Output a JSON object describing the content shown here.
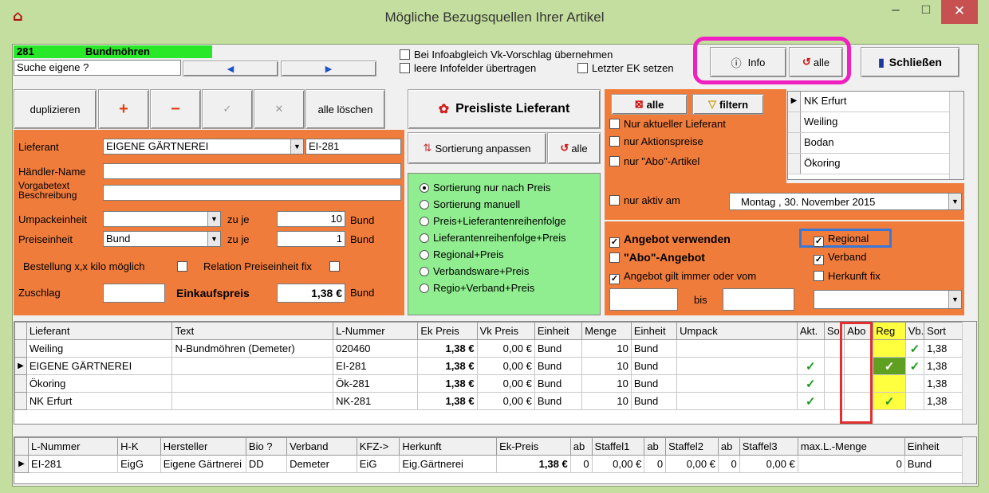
{
  "window": {
    "title": "Mögliche Bezugsquellen Ihrer Artikel",
    "minimize": "–",
    "maximize": "□",
    "close": "✕"
  },
  "article": {
    "number": "281",
    "name": "Bundmöhren",
    "search_placeholder": "Suche eigene ?"
  },
  "options": {
    "vk_vorschlag": "Bei Infoabgleich  Vk-Vorschlag übernehmen",
    "leere_felder": "leere Infofelder übertragen",
    "letzter_ek": "Letzter EK setzen"
  },
  "toolbar": {
    "info": "Info",
    "alle": "alle",
    "schliessen": "Schließen",
    "duplizieren": "duplizieren",
    "alle_loeschen": "alle löschen",
    "preisliste": "Preisliste Lieferant",
    "sortierung_anpassen": "Sortierung anpassen",
    "alle2": "alle"
  },
  "form": {
    "lieferant_label": "Lieferant",
    "lieferant_value": "EIGENE GÄRTNEREI",
    "lieferant_code": "EI-281",
    "haendler_label": "Händler-Name",
    "vorgabe_label1": "Vorgabetext",
    "vorgabe_label2": "Beschreibung",
    "umpack_label": "Umpackeinheit",
    "zuje1": "zu je",
    "umpack_qty": "10",
    "umpack_unit": "Bund",
    "preiseinheit_label": "Preiseinheit",
    "preiseinheit_value": "Bund",
    "zuje2": "zu je",
    "preis_qty": "1",
    "preis_unit": "Bund",
    "bestellung": "Bestellung x,x kilo möglich",
    "relation": "Relation Preiseinheit fix",
    "zuschlag_label": "Zuschlag",
    "einkaufspreis_label": "Einkaufspreis",
    "einkaufspreis_value": "1,38 €",
    "einkaufspreis_unit": "Bund"
  },
  "sort_options": [
    {
      "label": "Sortierung nur nach Preis",
      "selected": true
    },
    {
      "label": "Sortierung manuell",
      "selected": false
    },
    {
      "label": "Preis+Lieferantenreihenfolge",
      "selected": false
    },
    {
      "label": "Lieferantenreihenfolge+Preis",
      "selected": false
    },
    {
      "label": "Regional+Preis",
      "selected": false
    },
    {
      "label": "Verbandsware+Preis",
      "selected": false
    },
    {
      "label": "Regio+Verband+Preis",
      "selected": false
    }
  ],
  "filter": {
    "alle": "alle",
    "filtern": "filtern",
    "aktueller": "Nur aktueller Lieferant",
    "aktion": "nur Aktionspreise",
    "abo": "nur \"Abo\"-Artikel",
    "aktiv_am": "nur aktiv am",
    "date_day": "Montag",
    "date_rest": ", 30. November 2015",
    "lieferanten": [
      "NK Erfurt",
      "Weiling",
      "Bodan",
      "Ökoring"
    ]
  },
  "angebot": {
    "verwenden": "Angebot verwenden",
    "abo": "\"Abo\"-Angebot",
    "immer": "Angebot gilt immer  oder vom",
    "bis": "bis",
    "regional": "Regional",
    "verband": "Verband",
    "herkunft": "Herkunft fix"
  },
  "main_table": {
    "headers": [
      "Lieferant",
      "Text",
      "L-Nummer",
      "Ek Preis",
      "Vk Preis",
      "Einheit",
      "Menge",
      "Einheit",
      "Umpack",
      "Akt.",
      "So",
      "Abo",
      "Reg",
      "Vb.",
      "Sort"
    ],
    "rows": [
      [
        "Weiling",
        "N-Bundmöhren (Demeter)",
        "020460",
        "1,38 €",
        "0,00 €",
        "Bund",
        "10",
        "Bund",
        "",
        "",
        "",
        "",
        "",
        "✓",
        "1,38"
      ],
      [
        "EIGENE GÄRTNEREI",
        "",
        "EI-281",
        "1,38 €",
        "0,00 €",
        "Bund",
        "10",
        "Bund",
        "",
        "✓",
        "",
        "",
        "✓",
        "✓",
        "1,38"
      ],
      [
        "Ökoring",
        "",
        "Ök-281",
        "1,38 €",
        "0,00 €",
        "Bund",
        "10",
        "Bund",
        "",
        "✓",
        "",
        "",
        "",
        "",
        "1,38"
      ],
      [
        "NK Erfurt",
        "",
        "NK-281",
        "1,38 €",
        "0,00 €",
        "Bund",
        "10",
        "Bund",
        "",
        "✓",
        "",
        "",
        "✓",
        "",
        "1,38"
      ]
    ]
  },
  "detail_table": {
    "headers": [
      "L-Nummer",
      "H-K",
      "Hersteller",
      "Bio ?",
      "Verband",
      "KFZ->",
      "Herkunft",
      "Ek-Preis",
      "ab",
      "Staffel1",
      "ab",
      "Staffel2",
      "ab",
      "Staffel3",
      "max.L.-Menge",
      "Einheit"
    ],
    "rows": [
      [
        "EI-281",
        "EigG",
        "Eigene Gärtnerei",
        "DD",
        "Demeter",
        "EiG",
        "Eig.Gärtnerei",
        "1,38 €",
        "0",
        "0,00 €",
        "0",
        "0,00 €",
        "0",
        "0,00 €",
        "0",
        "Bund"
      ]
    ]
  },
  "colors": {
    "orange": "#f07c3c",
    "green_panel": "#90ee90",
    "highlight_magenta": "#f020c0",
    "highlight_red": "#e03030",
    "highlight_blue": "#3a78d8"
  }
}
